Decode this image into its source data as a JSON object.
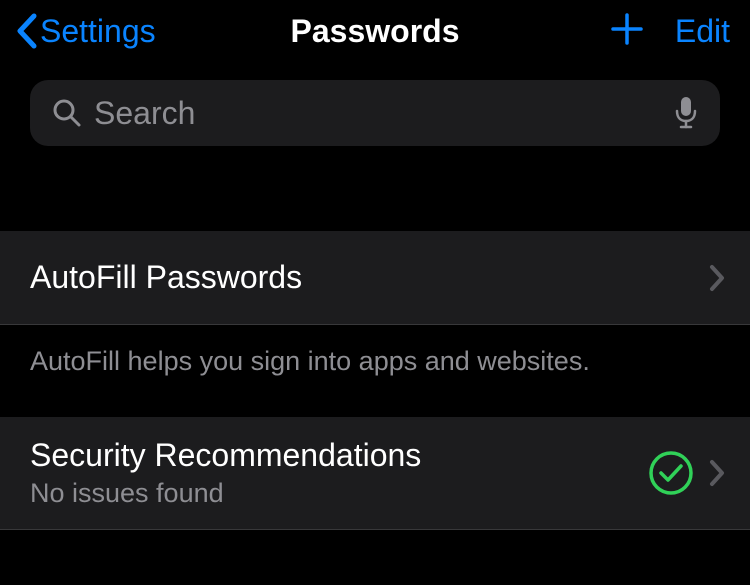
{
  "nav": {
    "back_label": "Settings",
    "title": "Passwords",
    "edit_label": "Edit"
  },
  "search": {
    "placeholder": "Search"
  },
  "rows": {
    "autofill": {
      "title": "AutoFill Passwords",
      "footer": "AutoFill helps you sign into apps and websites."
    },
    "security": {
      "title": "Security Recommendations",
      "subtitle": "No issues found",
      "status_color": "#30d158"
    }
  }
}
